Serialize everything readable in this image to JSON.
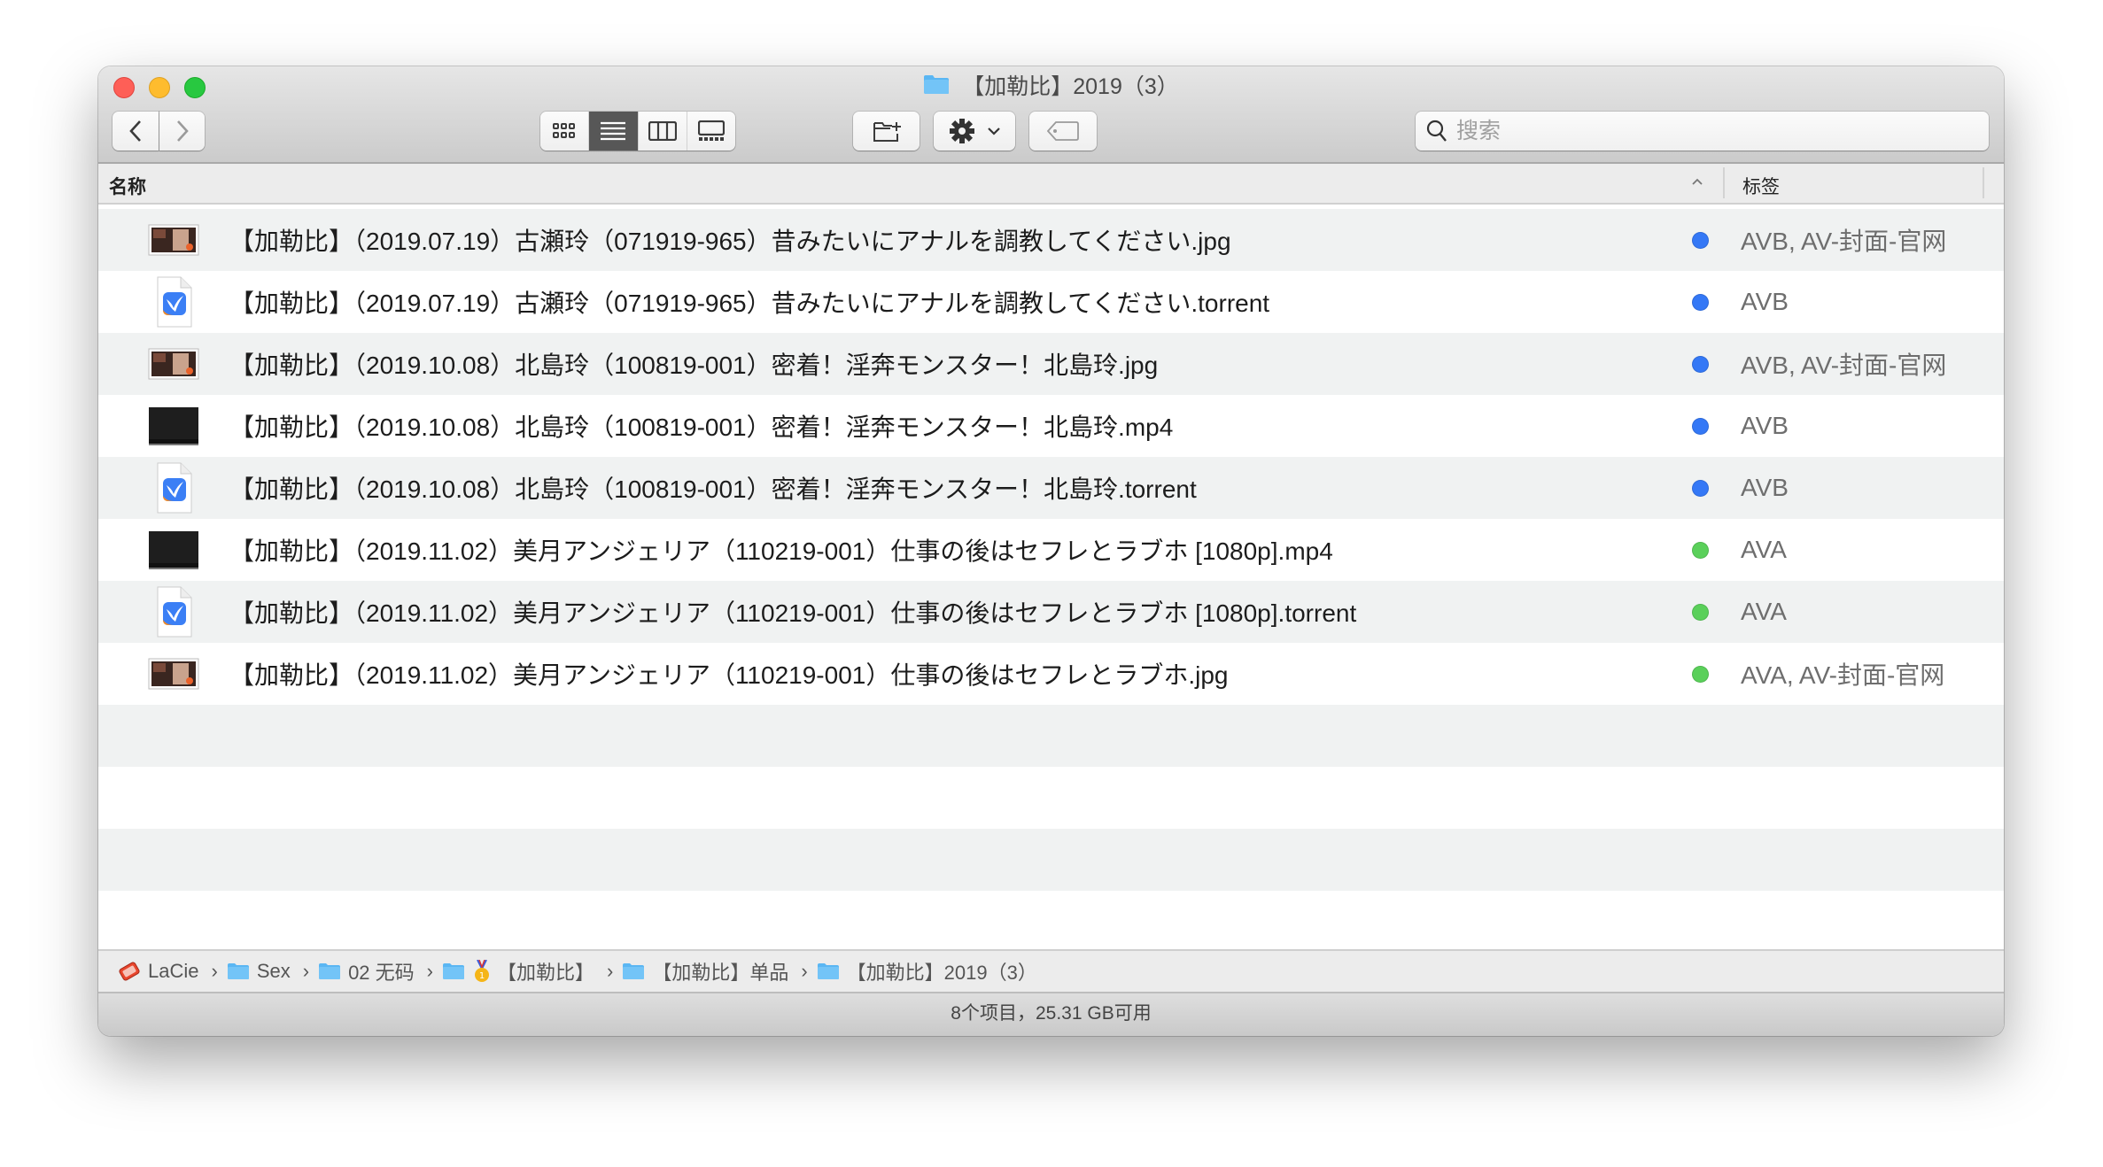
{
  "window": {
    "title": "【加勒比】2019（3）",
    "traffic_lights": {
      "close": "close",
      "minimize": "minimize",
      "zoom": "zoom"
    }
  },
  "toolbar": {
    "back_icon": "chevron-left-icon",
    "forward_icon": "chevron-right-icon",
    "view_modes": [
      {
        "name": "icon-view",
        "active": false
      },
      {
        "name": "list-view",
        "active": true
      },
      {
        "name": "column-view",
        "active": false
      },
      {
        "name": "gallery-view",
        "active": false
      }
    ],
    "new_folder_icon": "new-folder-icon",
    "action_icon": "gear-icon",
    "tag_icon": "tag-icon",
    "search_placeholder": "搜索",
    "search_value": ""
  },
  "columns": {
    "name": "名称",
    "sort_indicator": "^",
    "tags": "标签"
  },
  "tag_colors": {
    "AVB": "#3478f6",
    "AVA": "#5ad05a"
  },
  "files": [
    {
      "name": "【加勒比】（2019.07.19）古瀬玲（071919-965）昔みたいにアナルを調教してください.jpg",
      "kind": "jpg",
      "tags": "AVB, AV-封面-官网",
      "dot_color": "#3478f6"
    },
    {
      "name": "【加勒比】（2019.07.19）古瀬玲（071919-965）昔みたいにアナルを調教してください.torrent",
      "kind": "torrent",
      "tags": "AVB",
      "dot_color": "#3478f6"
    },
    {
      "name": "【加勒比】（2019.10.08）北島玲（100819-001）密着！淫奔モンスター！北島玲.jpg",
      "kind": "jpg",
      "tags": "AVB, AV-封面-官网",
      "dot_color": "#3478f6"
    },
    {
      "name": "【加勒比】（2019.10.08）北島玲（100819-001）密着！淫奔モンスター！北島玲.mp4",
      "kind": "mp4",
      "tags": "AVB",
      "dot_color": "#3478f6"
    },
    {
      "name": "【加勒比】（2019.10.08）北島玲（100819-001）密着！淫奔モンスター！北島玲.torrent",
      "kind": "torrent",
      "tags": "AVB",
      "dot_color": "#3478f6"
    },
    {
      "name": "【加勒比】（2019.11.02）美月アンジェリア（110219-001）仕事の後はセフレとラブホ [1080p].mp4",
      "kind": "mp4",
      "tags": "AVA",
      "dot_color": "#5ad05a"
    },
    {
      "name": "【加勒比】（2019.11.02）美月アンジェリア（110219-001）仕事の後はセフレとラブホ [1080p].torrent",
      "kind": "torrent",
      "tags": "AVA",
      "dot_color": "#5ad05a"
    },
    {
      "name": "【加勒比】（2019.11.02）美月アンジェリア（110219-001）仕事の後はセフレとラブホ.jpg",
      "kind": "jpg",
      "tags": "AVA, AV-封面-官网",
      "dot_color": "#5ad05a"
    }
  ],
  "path": [
    {
      "label": "LaCie",
      "icon": "external-drive-icon"
    },
    {
      "label": "Sex",
      "icon": "folder-icon"
    },
    {
      "label": "02 无码",
      "icon": "folder-icon"
    },
    {
      "label": "【加勒比】",
      "icon": "folder-icon",
      "badge": "medal-icon"
    },
    {
      "label": "【加勒比】单品",
      "icon": "folder-icon"
    },
    {
      "label": "【加勒比】2019（3）",
      "icon": "folder-icon"
    }
  ],
  "status": "8个项目，25.31 GB可用"
}
